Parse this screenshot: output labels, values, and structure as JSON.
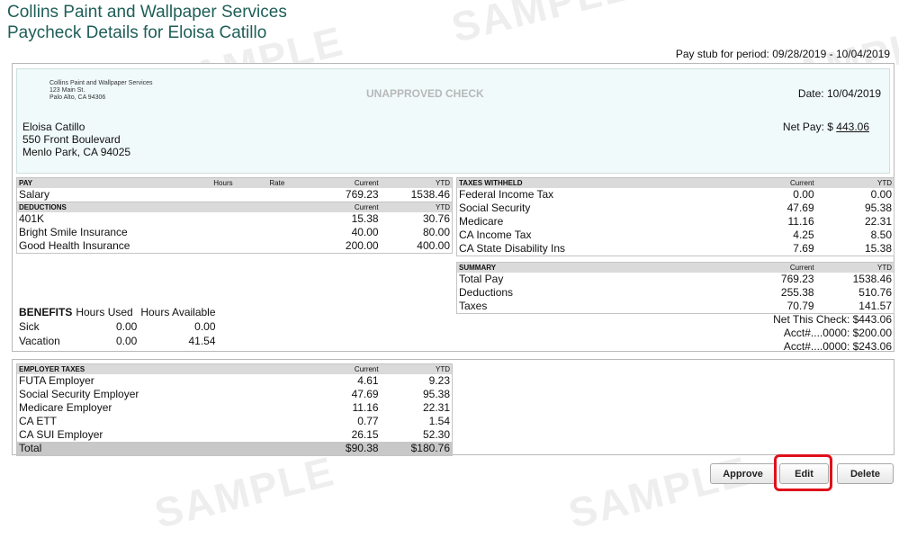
{
  "watermark_text": "SAMPLE",
  "header": {
    "company": "Collins Paint and Wallpaper Services",
    "title": "Paycheck Details for Eloisa Catillo",
    "period": "Pay stub for period: 09/28/2019 - 10/04/2019"
  },
  "check": {
    "company_name": "Collins Paint and Wallpaper Services",
    "company_street": "123 Main St.",
    "company_city": "Palo Alto, CA 94306",
    "status": "UNAPPROVED CHECK",
    "date": "Date: 10/04/2019",
    "payee_name": "Eloisa Catillo",
    "payee_street": "550 Front Boulevard",
    "payee_city": "Menlo Park, CA 94025",
    "net_pay_label": "Net Pay: $",
    "net_pay_value": "443.06"
  },
  "pay": {
    "headers": [
      "PAY",
      "Hours",
      "Rate",
      "Current",
      "YTD"
    ],
    "rows": [
      {
        "name": "Salary",
        "hours": "",
        "rate": "",
        "current": "769.23",
        "ytd": "1538.46"
      }
    ]
  },
  "deductions": {
    "headers": [
      "DEDUCTIONS",
      "Current",
      "YTD"
    ],
    "rows": [
      {
        "name": "401K",
        "current": "15.38",
        "ytd": "30.76"
      },
      {
        "name": "Bright Smile Insurance",
        "current": "40.00",
        "ytd": "80.00"
      },
      {
        "name": "Good Health Insurance",
        "current": "200.00",
        "ytd": "400.00"
      }
    ]
  },
  "taxes_withheld": {
    "headers": [
      "TAXES WITHHELD",
      "Current",
      "YTD"
    ],
    "rows": [
      {
        "name": "Federal Income Tax",
        "current": "0.00",
        "ytd": "0.00"
      },
      {
        "name": "Social Security",
        "current": "47.69",
        "ytd": "95.38"
      },
      {
        "name": "Medicare",
        "current": "11.16",
        "ytd": "22.31"
      },
      {
        "name": "CA Income Tax",
        "current": "4.25",
        "ytd": "8.50"
      },
      {
        "name": "CA State Disability Ins",
        "current": "7.69",
        "ytd": "15.38"
      }
    ]
  },
  "summary": {
    "headers": [
      "SUMMARY",
      "Current",
      "YTD"
    ],
    "rows": [
      {
        "name": "Total Pay",
        "current": "769.23",
        "ytd": "1538.46"
      },
      {
        "name": "Deductions",
        "current": "255.38",
        "ytd": "510.76"
      },
      {
        "name": "Taxes",
        "current": "70.79",
        "ytd": "141.57"
      }
    ]
  },
  "net_check": {
    "line1": "Net This Check: $443.06",
    "line2": "Acct#....0000: $200.00",
    "line3": "Acct#....0000: $243.06"
  },
  "benefits": {
    "title": "BENEFITS",
    "col_used": "Hours Used",
    "col_available": "Hours Available",
    "rows": [
      {
        "name": "Sick",
        "used": "0.00",
        "available": "0.00"
      },
      {
        "name": "Vacation",
        "used": "0.00",
        "available": "41.54"
      }
    ]
  },
  "employer_taxes": {
    "headers": [
      "EMPLOYER TAXES",
      "Current",
      "YTD"
    ],
    "rows": [
      {
        "name": "FUTA Employer",
        "current": "4.61",
        "ytd": "9.23"
      },
      {
        "name": "Social Security Employer",
        "current": "47.69",
        "ytd": "95.38"
      },
      {
        "name": "Medicare Employer",
        "current": "11.16",
        "ytd": "22.31"
      },
      {
        "name": "CA ETT",
        "current": "0.77",
        "ytd": "1.54"
      },
      {
        "name": "CA SUI Employer",
        "current": "26.15",
        "ytd": "52.30"
      }
    ],
    "total": {
      "name": "Total",
      "current": "$90.38",
      "ytd": "$180.76"
    }
  },
  "buttons": {
    "approve": "Approve",
    "edit": "Edit",
    "delete": "Delete"
  },
  "colors": {
    "title": "#1f5e58",
    "check_bg": "#f0fafa",
    "highlight": "#e0101a"
  }
}
